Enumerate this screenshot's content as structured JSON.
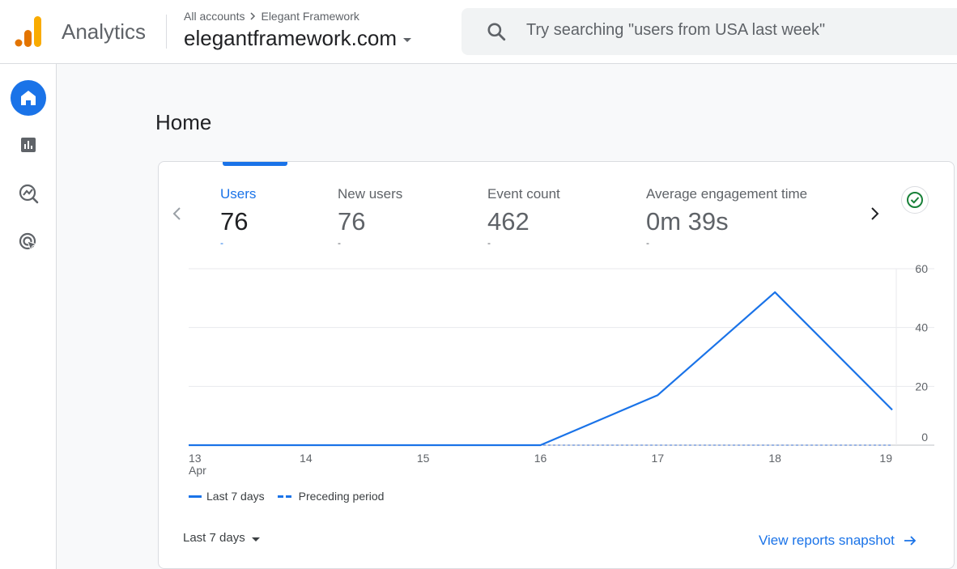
{
  "header": {
    "product_name": "Analytics",
    "breadcrumb": {
      "root": "All accounts",
      "account": "Elegant Framework"
    },
    "property": "elegantframework.com",
    "search_placeholder": "Try searching \"users from USA last week\""
  },
  "sidebar": {
    "items": [
      {
        "name": "Home",
        "icon": "home-icon",
        "active": true
      },
      {
        "name": "Reports",
        "icon": "bar-chart-icon",
        "active": false
      },
      {
        "name": "Explore",
        "icon": "explore-icon",
        "active": false
      },
      {
        "name": "Advertising",
        "icon": "advertising-icon",
        "active": false
      }
    ]
  },
  "page": {
    "title": "Home"
  },
  "metrics": [
    {
      "label": "Users",
      "value": "76",
      "change": "-",
      "selected": true
    },
    {
      "label": "New users",
      "value": "76",
      "change": "-",
      "selected": false
    },
    {
      "label": "Event count",
      "value": "462",
      "change": "-",
      "selected": false
    },
    {
      "label": "Average engagement time",
      "value": "0m 39s",
      "change": "-",
      "selected": false
    }
  ],
  "chart_data": {
    "type": "line",
    "x": [
      "13",
      "14",
      "15",
      "16",
      "17",
      "18",
      "19"
    ],
    "x_sublabels": [
      "Apr",
      "",
      "",
      "",
      "",
      "",
      ""
    ],
    "series": [
      {
        "name": "Last 7 days",
        "style": "solid",
        "values": [
          0,
          0,
          0,
          0,
          17,
          52,
          12
        ]
      },
      {
        "name": "Preceding period",
        "style": "dashed",
        "values": [
          0,
          0,
          0,
          0,
          0,
          0,
          0
        ]
      }
    ],
    "y_ticks": [
      0,
      20,
      40,
      60
    ],
    "ylim": [
      0,
      60
    ],
    "y_axis_side": "right",
    "grid": true,
    "legend_position": "bottom-left",
    "color": "#1a73e8"
  },
  "footer": {
    "date_range": "Last 7 days",
    "view_link": "View reports snapshot"
  },
  "colors": {
    "accent": "#1a73e8",
    "check": "#188038"
  }
}
